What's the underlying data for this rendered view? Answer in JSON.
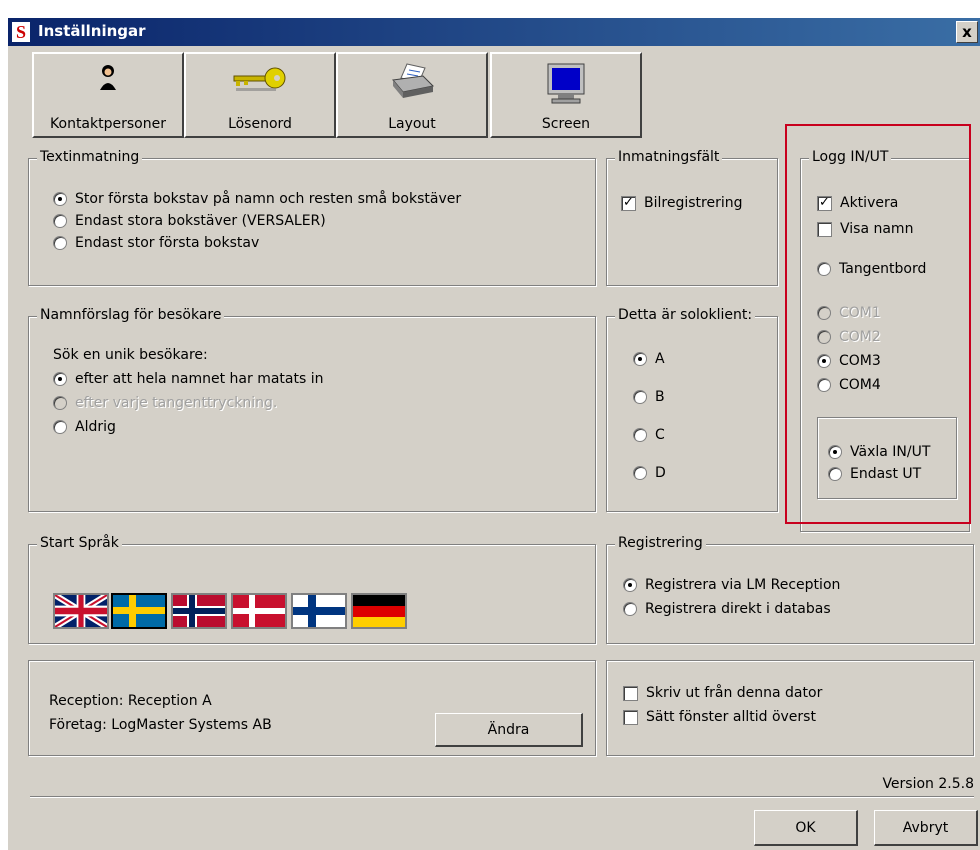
{
  "window": {
    "title": "Inställningar",
    "close_label": "x",
    "app_icon_letter": "S"
  },
  "toolbar": [
    {
      "label": "Kontaktpersoner",
      "icon": "person-icon"
    },
    {
      "label": "Lösenord",
      "icon": "key-icon"
    },
    {
      "label": "Layout",
      "icon": "printer-icon"
    },
    {
      "label": "Screen",
      "icon": "monitor-icon"
    }
  ],
  "textinmatning": {
    "title": "Textinmatning",
    "options": [
      "Stor första bokstav på namn och resten små bokstäver",
      "Endast stora bokstäver (VERSALER)",
      "Endast stor första bokstav"
    ],
    "selected": 0
  },
  "inmatningsfalt": {
    "title": "Inmatningsfält",
    "bilregistrering": "Bilregistrering",
    "bilregistrering_checked": true
  },
  "logg": {
    "title": "Logg IN/UT",
    "aktivera": "Aktivera",
    "aktivera_checked": true,
    "visa_namn": "Visa namn",
    "visa_namn_checked": false,
    "tangentbord": "Tangentbord",
    "com1": "COM1",
    "com2": "COM2",
    "com3": "COM3",
    "com4": "COM4",
    "selected_port": "COM3",
    "vaxla": "Växla IN/UT",
    "endast_ut": "Endast UT",
    "selected_mode": "Växla IN/UT"
  },
  "namnforslag": {
    "title": "Namnförslag för besökare",
    "prompt": "Sök en unik besökare:",
    "options": [
      "efter att hela namnet har matats in",
      "efter varje tangenttryckning.",
      "Aldrig"
    ],
    "selected": 0
  },
  "soloklient": {
    "title": "Detta är soloklient:",
    "options": [
      "A",
      "B",
      "C",
      "D"
    ],
    "selected": "A"
  },
  "sprak": {
    "title": "Start Språk",
    "flags": [
      "uk-flag-icon",
      "sweden-flag-icon",
      "norway-flag-icon",
      "denmark-flag-icon",
      "finland-flag-icon",
      "germany-flag-icon"
    ],
    "selected": "sweden-flag-icon"
  },
  "registrering": {
    "title": "Registrering",
    "options": [
      "Registrera via LM Reception",
      "Registrera direkt i databas"
    ],
    "selected": 0
  },
  "info": {
    "reception": "Reception: Reception A",
    "foretag": "Företag: LogMaster Systems AB",
    "andra": "Ändra"
  },
  "options": {
    "skriv_ut": "Skriv ut från denna dator",
    "alltid_overst": "Sätt fönster alltid överst"
  },
  "version": "Version 2.5.8",
  "buttons": {
    "ok": "OK",
    "avbryt": "Avbryt"
  },
  "colors": {
    "highlight": "#c8001e",
    "face": "#d4d0c8",
    "title_bar": "#0a246a"
  }
}
